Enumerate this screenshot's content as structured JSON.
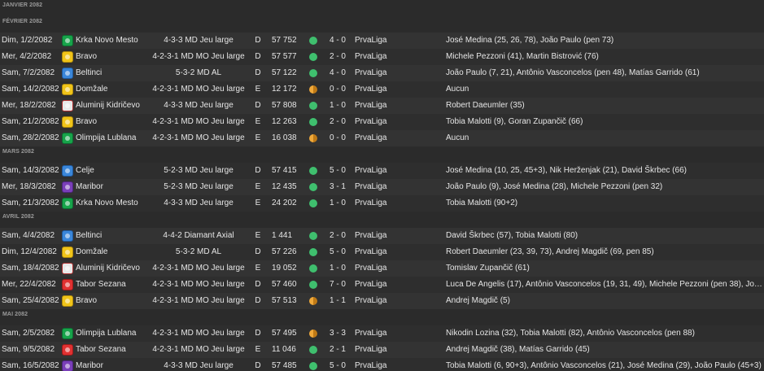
{
  "colors": {
    "win": "#3fbf6e",
    "draw": "#f0a93a",
    "background": "#2b2b2b"
  },
  "groups": [
    {
      "month": "JANVIER 2082",
      "matches": []
    },
    {
      "month": "FÉVRIER 2082",
      "matches": [
        {
          "date": "Dim, 1/2/2082",
          "logo": "green",
          "opponent": "Krka Novo Mesto",
          "formation": "4-3-3 MD Jeu large",
          "venue": "D",
          "attendance": "57 752",
          "result": "win",
          "score": "4 - 0",
          "competition": "PrvaLiga",
          "scorers": "José Medina (25, 26, 78), João Paulo (pen 73)"
        },
        {
          "date": "Mer, 4/2/2082",
          "logo": "yellow",
          "opponent": "Bravo",
          "formation": "4-2-3-1 MD MO Jeu large",
          "venue": "D",
          "attendance": "57 577",
          "result": "win",
          "score": "2 - 0",
          "competition": "PrvaLiga",
          "scorers": "Michele Pezzoni (41), Martin Bistrović (76)"
        },
        {
          "date": "Sam, 7/2/2082",
          "logo": "blue",
          "opponent": "Beltinci",
          "formation": "5-3-2 MD AL",
          "venue": "D",
          "attendance": "57 122",
          "result": "win",
          "score": "4 - 0",
          "competition": "PrvaLiga",
          "scorers": "João Paulo (7, 21), Antônio Vasconcelos (pen 48), Matías Garrido (61)"
        },
        {
          "date": "Sam, 14/2/2082",
          "logo": "yellow",
          "opponent": "Domžale",
          "formation": "4-2-3-1 MD MO Jeu large",
          "venue": "E",
          "attendance": "12 172",
          "result": "draw",
          "score": "0 - 0",
          "competition": "PrvaLiga",
          "scorers": "Aucun"
        },
        {
          "date": "Mer, 18/2/2082",
          "logo": "white",
          "opponent": "Aluminij Kidričevo",
          "formation": "4-3-3 MD Jeu large",
          "venue": "D",
          "attendance": "57 808",
          "result": "win",
          "score": "1 - 0",
          "competition": "PrvaLiga",
          "scorers": "Robert Daeumler (35)"
        },
        {
          "date": "Sam, 21/2/2082",
          "logo": "yellow",
          "opponent": "Bravo",
          "formation": "4-2-3-1 MD MO Jeu large",
          "venue": "E",
          "attendance": "12 263",
          "result": "win",
          "score": "2 - 0",
          "competition": "PrvaLiga",
          "scorers": "Tobia Malotti (9), Goran Zupančič (66)"
        },
        {
          "date": "Sam, 28/2/2082",
          "logo": "green",
          "opponent": "Olimpija Lublana",
          "formation": "4-2-3-1 MD MO Jeu large",
          "venue": "E",
          "attendance": "16 038",
          "result": "draw",
          "score": "0 - 0",
          "competition": "PrvaLiga",
          "scorers": "Aucun"
        }
      ]
    },
    {
      "month": "MARS 2082",
      "matches": [
        {
          "date": "Sam, 14/3/2082",
          "logo": "blue",
          "opponent": "Celje",
          "formation": "5-2-3 MD Jeu large",
          "venue": "D",
          "attendance": "57 415",
          "result": "win",
          "score": "5 - 0",
          "competition": "PrvaLiga",
          "scorers": "José Medina (10, 25, 45+3), Nik Heržen­jak (21), David Škrbec (66)"
        },
        {
          "date": "Mer, 18/3/2082",
          "logo": "purple",
          "opponent": "Maribor",
          "formation": "5-2-3 MD Jeu large",
          "venue": "E",
          "attendance": "12 435",
          "result": "win",
          "score": "3 - 1",
          "competition": "PrvaLiga",
          "scorers": "João Paulo (9), José Medina (28), Michele Pezzoni (pen 32)"
        },
        {
          "date": "Sam, 21/3/2082",
          "logo": "green",
          "opponent": "Krka Novo Mesto",
          "formation": "4-3-3 MD Jeu large",
          "venue": "E",
          "attendance": "24 202",
          "result": "win",
          "score": "1 - 0",
          "competition": "PrvaLiga",
          "scorers": "Tobia Malotti (90+2)"
        }
      ]
    },
    {
      "month": "AVRIL 2082",
      "matches": [
        {
          "date": "Sam, 4/4/2082",
          "logo": "blue",
          "opponent": "Beltinci",
          "formation": "4-4-2 Diamant Axial",
          "venue": "E",
          "attendance": "1 441",
          "result": "win",
          "score": "2 - 0",
          "competition": "PrvaLiga",
          "scorers": "David Škrbec (57), Tobia Malotti (80)"
        },
        {
          "date": "Dim, 12/4/2082",
          "logo": "yellow",
          "opponent": "Domžale",
          "formation": "5-3-2 MD AL",
          "venue": "D",
          "attendance": "57 226",
          "result": "win",
          "score": "5 - 0",
          "competition": "PrvaLiga",
          "scorers": "Robert Daeumler (23, 39, 73), Andrej Magdič (69, pen 85)"
        },
        {
          "date": "Sam, 18/4/2082",
          "logo": "white",
          "opponent": "Aluminij Kidričevo",
          "formation": "4-2-3-1 MD MO Jeu large",
          "venue": "E",
          "attendance": "19 052",
          "result": "win",
          "score": "1 - 0",
          "competition": "PrvaLiga",
          "scorers": "Tomislav Zupančič (61)"
        },
        {
          "date": "Mer, 22/4/2082",
          "logo": "red",
          "opponent": "Tabor Sezana",
          "formation": "4-2-3-1 MD MO Jeu large",
          "venue": "D",
          "attendance": "57 460",
          "result": "win",
          "score": "7 - 0",
          "competition": "PrvaLiga",
          "scorers": "Luca De Angelis (17), Antônio Vasconcelos (19, 31, 49), Michele Pezzoni (pen 38), José Medina…"
        },
        {
          "date": "Sam, 25/4/2082",
          "logo": "yellow",
          "opponent": "Bravo",
          "formation": "4-2-3-1 MD MO Jeu large",
          "venue": "D",
          "attendance": "57 513",
          "result": "draw",
          "score": "1 - 1",
          "competition": "PrvaLiga",
          "scorers": "Andrej Magdič (5)"
        }
      ]
    },
    {
      "month": "MAI 2082",
      "matches": [
        {
          "date": "Sam, 2/5/2082",
          "logo": "green",
          "opponent": "Olimpija Lublana",
          "formation": "4-2-3-1 MD MO Jeu large",
          "venue": "D",
          "attendance": "57 495",
          "result": "draw",
          "score": "3 - 3",
          "competition": "PrvaLiga",
          "scorers": "Nikodin Lozina (32), Tobia Malotti (82), Antônio Vasconcelos (pen 88)"
        },
        {
          "date": "Sam, 9/5/2082",
          "logo": "red",
          "opponent": "Tabor Sezana",
          "formation": "4-2-3-1 MD MO Jeu large",
          "venue": "E",
          "attendance": "11 046",
          "result": "win",
          "score": "2 - 1",
          "competition": "PrvaLiga",
          "scorers": "Andrej Magdič (38), Matías Garrido (45)"
        },
        {
          "date": "Sam, 16/5/2082",
          "logo": "purple",
          "opponent": "Maribor",
          "formation": "4-3-3 MD Jeu large",
          "venue": "D",
          "attendance": "57 485",
          "result": "win",
          "score": "5 - 0",
          "competition": "PrvaLiga",
          "scorers": "Tobia Malotti (6, 90+3), Antônio Vasconcelos (21), José Medina (29), João Paulo (45+3)"
        }
      ]
    }
  ]
}
